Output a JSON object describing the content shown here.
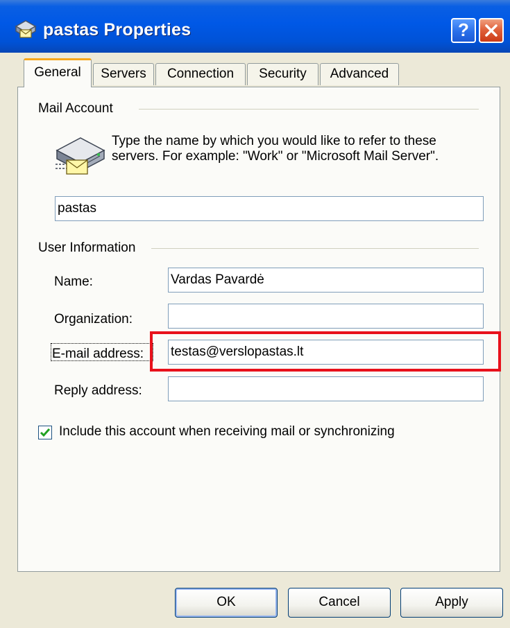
{
  "window": {
    "title": "pastas Properties"
  },
  "titlebar": {
    "help_label": "?",
    "icons": [
      "account-icon",
      "help-icon",
      "close-icon"
    ]
  },
  "tabs": [
    {
      "label": "General",
      "active": true
    },
    {
      "label": "Servers",
      "active": false
    },
    {
      "label": "Connection",
      "active": false
    },
    {
      "label": "Security",
      "active": false
    },
    {
      "label": "Advanced",
      "active": false
    }
  ],
  "mail_account": {
    "group_title": "Mail Account",
    "description": "Type the name by which you would like to refer to these servers.  For example: \"Work\" or \"Microsoft Mail Server\".",
    "account_name": "pastas"
  },
  "user_information": {
    "group_title": "User Information",
    "name_label": "Name:",
    "name_value": "Vardas Pavardė",
    "organization_label": "Organization:",
    "organization_value": "",
    "email_label": "E-mail address:",
    "email_value": "testas@verslopastas.lt",
    "reply_label": "Reply address:",
    "reply_value": ""
  },
  "include_account": {
    "label": "Include this account when receiving mail or synchronizing",
    "checked": true
  },
  "buttons": {
    "ok": "OK",
    "cancel": "Cancel",
    "apply": "Apply"
  },
  "colors": {
    "titlebar": "#0058e6",
    "dialog_bg": "#ece9d8",
    "highlight": "#e8111b",
    "active_tab_accent": "#f7a71b"
  }
}
